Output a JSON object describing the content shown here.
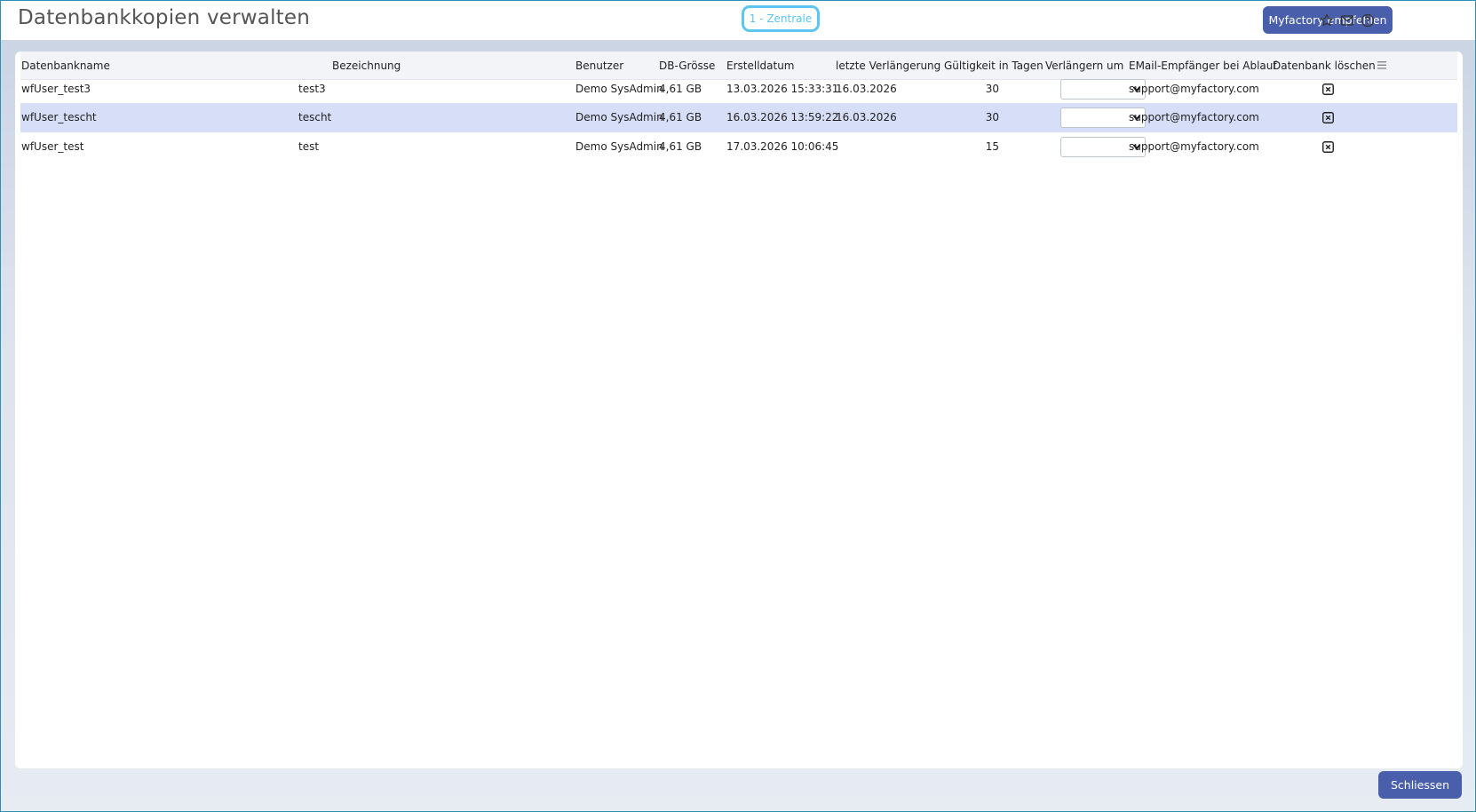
{
  "header": {
    "title": "Datenbankkopien verwalten",
    "company_chip": "1 - Zentrale",
    "recommend_label": "Myfactory empfehlen",
    "icons": [
      "star-icon",
      "mail-icon",
      "help-icon"
    ]
  },
  "table": {
    "columns": [
      "Datenbankname",
      "Bezeichnung",
      "Benutzer",
      "DB-Grösse",
      "Erstelldatum",
      "letzte Verlängerung",
      "Gültigkeit in Tagen",
      "Verlängern um",
      "EMail-Empfänger bei Ablauf",
      "Datenbank löschen"
    ],
    "rows": [
      {
        "name": "wfUser_test3",
        "label": "test3",
        "user": "Demo SysAdmin",
        "size": "4,61 GB",
        "created": "13.03.2026 15:33:31",
        "extended": "16.03.2026",
        "validity": "30",
        "extend_by": "",
        "email": "support@myfactory.com",
        "selected": false
      },
      {
        "name": "wfUser_tescht",
        "label": "tescht",
        "user": "Demo SysAdmin",
        "size": "4,61 GB",
        "created": "16.03.2026 13:59:22",
        "extended": "16.03.2026",
        "validity": "30",
        "extend_by": "",
        "email": "support@myfactory.com",
        "selected": true
      },
      {
        "name": "wfUser_test",
        "label": "test",
        "user": "Demo SysAdmin",
        "size": "4,61 GB",
        "created": "17.03.2026 10:06:45",
        "extended": "",
        "validity": "15",
        "extend_by": "",
        "email": "support@myfactory.com",
        "selected": false
      }
    ]
  },
  "footer": {
    "close_label": "Schliessen"
  },
  "colors": {
    "accent": "#4a5fab",
    "chip": "#5cc6f0",
    "selected_row": "#d6def8"
  }
}
